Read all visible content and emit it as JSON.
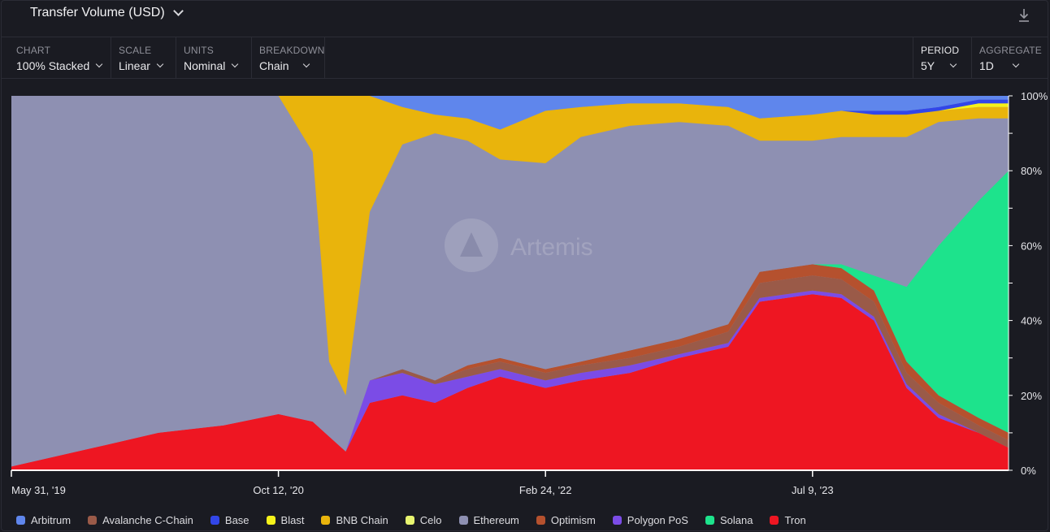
{
  "header": {
    "title": "Transfer Volume (USD)"
  },
  "controls": [
    {
      "label": "CHART",
      "value": "100% Stacked"
    },
    {
      "label": "SCALE",
      "value": "Linear"
    },
    {
      "label": "UNITS",
      "value": "Nominal"
    },
    {
      "label": "BREAKDOWN",
      "value": "Chain"
    }
  ],
  "period": {
    "label": "PERIOD",
    "value": "5Y"
  },
  "aggregate": {
    "label": "AGGREGATE",
    "value": "1D"
  },
  "watermark": "Artemis",
  "chart_data": {
    "type": "area",
    "stacking": "100%",
    "title": "Transfer Volume (USD)",
    "xlabel": "",
    "ylabel": "",
    "x_ticks": [
      "May 31, '19",
      "Oct 12, '20",
      "Feb 24, '22",
      "Jul 9, '23"
    ],
    "y_ticks": [
      "0%",
      "20%",
      "40%",
      "60%",
      "80%",
      "100%"
    ],
    "ylim": [
      0,
      100
    ],
    "grid": false,
    "legend_position": "bottom",
    "x": [
      "2019-05-31",
      "2019-11-01",
      "2020-03-01",
      "2020-07-01",
      "2020-10-12",
      "2020-12-15",
      "2021-01-15",
      "2021-02-15",
      "2021-04-01",
      "2021-06-01",
      "2021-08-01",
      "2021-10-01",
      "2021-12-01",
      "2022-02-24",
      "2022-05-01",
      "2022-08-01",
      "2022-11-01",
      "2023-02-01",
      "2023-04-01",
      "2023-07-09",
      "2023-09-01",
      "2023-11-01",
      "2024-01-01",
      "2024-03-01",
      "2024-05-15",
      "2024-07-10"
    ],
    "series": [
      {
        "name": "Tron",
        "color": "#ee1622",
        "values": [
          1,
          6,
          10,
          12,
          15,
          13,
          9,
          5,
          18,
          20,
          18,
          22,
          25,
          22,
          24,
          26,
          30,
          33,
          45,
          47,
          46,
          40,
          22,
          14,
          10,
          6
        ]
      },
      {
        "name": "Polygon PoS",
        "color": "#7b4ce6",
        "values": [
          0,
          0,
          0,
          0,
          0,
          0,
          0,
          0,
          6,
          6,
          5,
          3,
          2,
          2,
          2,
          2,
          1,
          1,
          1,
          1,
          1,
          1,
          1,
          1,
          0,
          0
        ]
      },
      {
        "name": "Avalanche C-Chain",
        "color": "#9a5a48",
        "values": [
          0,
          0,
          0,
          0,
          0,
          0,
          0,
          0,
          0,
          1,
          1,
          2,
          2,
          2,
          2,
          2,
          2,
          3,
          4,
          4,
          4,
          4,
          3,
          3,
          2,
          2
        ]
      },
      {
        "name": "Optimism",
        "color": "#b5512e",
        "values": [
          0,
          0,
          0,
          0,
          0,
          0,
          0,
          0,
          0,
          0,
          0,
          1,
          1,
          1,
          1,
          2,
          2,
          2,
          3,
          3,
          3,
          3,
          3,
          2,
          2,
          2
        ]
      },
      {
        "name": "Solana",
        "color": "#1de38c",
        "values": [
          0,
          0,
          0,
          0,
          0,
          0,
          0,
          0,
          0,
          0,
          0,
          0,
          0,
          0,
          0,
          0,
          0,
          0,
          0,
          0,
          1,
          4,
          20,
          40,
          58,
          70
        ]
      },
      {
        "name": "Celo",
        "color": "#e8f570",
        "values": [
          0,
          0,
          0,
          0,
          0,
          0,
          0,
          0,
          0,
          0,
          0,
          0,
          0,
          0,
          0,
          0,
          0,
          0,
          0,
          0,
          0,
          0,
          0,
          0,
          0,
          0
        ]
      },
      {
        "name": "Ethereum",
        "color": "#8e90b2",
        "values": [
          99,
          94,
          90,
          88,
          85,
          72,
          20,
          15,
          45,
          60,
          66,
          60,
          53,
          55,
          60,
          60,
          58,
          53,
          35,
          33,
          34,
          37,
          40,
          33,
          22,
          14
        ]
      },
      {
        "name": "BNB Chain",
        "color": "#e9b40c",
        "values": [
          0,
          0,
          0,
          0,
          0,
          15,
          71,
          80,
          31,
          10,
          5,
          6,
          8,
          14,
          8,
          6,
          5,
          5,
          6,
          7,
          7,
          6,
          6,
          3,
          3,
          3
        ]
      },
      {
        "name": "Blast",
        "color": "#f5f21a",
        "values": [
          0,
          0,
          0,
          0,
          0,
          0,
          0,
          0,
          0,
          0,
          0,
          0,
          0,
          0,
          0,
          0,
          0,
          0,
          0,
          0,
          0,
          0,
          0,
          0,
          1,
          1
        ]
      },
      {
        "name": "Base",
        "color": "#3246e8",
        "values": [
          0,
          0,
          0,
          0,
          0,
          0,
          0,
          0,
          0,
          0,
          0,
          0,
          0,
          0,
          0,
          0,
          0,
          0,
          0,
          0,
          0,
          1,
          1,
          1,
          1,
          1
        ]
      },
      {
        "name": "Arbitrum",
        "color": "#5f86ec",
        "values": [
          0,
          0,
          0,
          0,
          0,
          0,
          0,
          0,
          0,
          3,
          5,
          6,
          9,
          4,
          3,
          2,
          2,
          3,
          6,
          5,
          4,
          4,
          4,
          3,
          1,
          1
        ]
      }
    ],
    "legend": [
      {
        "name": "Arbitrum",
        "color": "#5f86ec"
      },
      {
        "name": "Avalanche C-Chain",
        "color": "#9a5a48"
      },
      {
        "name": "Base",
        "color": "#3246e8"
      },
      {
        "name": "Blast",
        "color": "#f5f21a"
      },
      {
        "name": "BNB Chain",
        "color": "#e9b40c"
      },
      {
        "name": "Celo",
        "color": "#e8f570"
      },
      {
        "name": "Ethereum",
        "color": "#8e90b2"
      },
      {
        "name": "Optimism",
        "color": "#b5512e"
      },
      {
        "name": "Polygon PoS",
        "color": "#7b4ce6"
      },
      {
        "name": "Solana",
        "color": "#1de38c"
      },
      {
        "name": "Tron",
        "color": "#ee1622"
      }
    ]
  }
}
